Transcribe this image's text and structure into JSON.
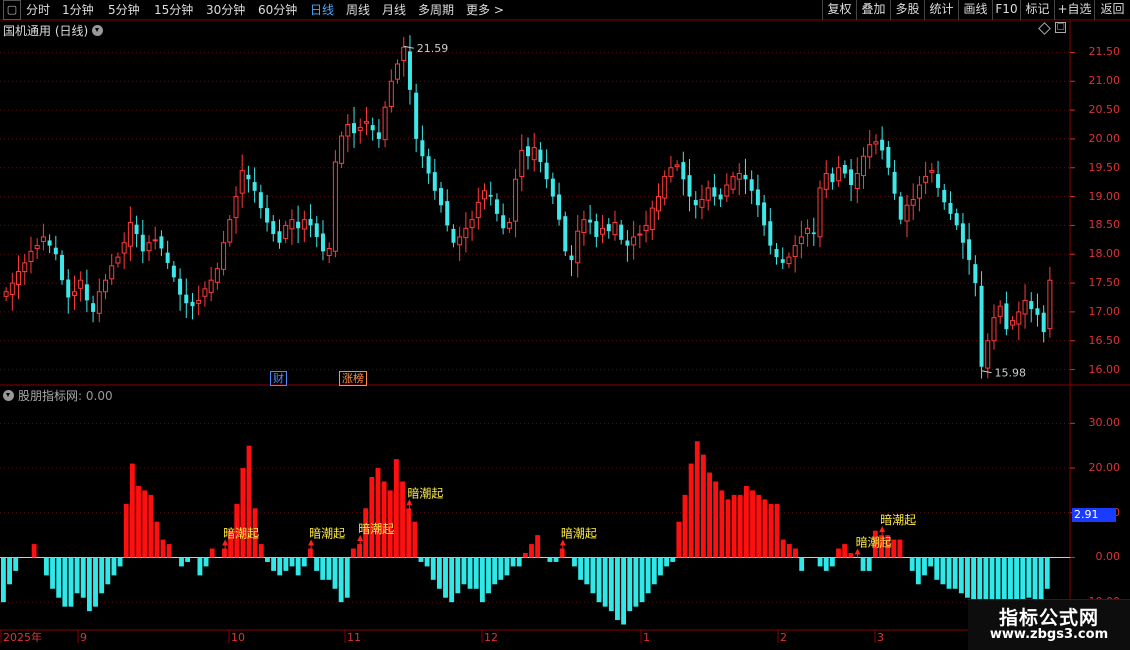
{
  "toolbar": {
    "menu_icon": "window-menu-icon",
    "periods": [
      {
        "label": "分时",
        "active": false
      },
      {
        "label": "1分钟",
        "active": false
      },
      {
        "label": "5分钟",
        "active": false
      },
      {
        "label": "15分钟",
        "active": false
      },
      {
        "label": "30分钟",
        "active": false
      },
      {
        "label": "60分钟",
        "active": false
      },
      {
        "label": "日线",
        "active": true
      },
      {
        "label": "周线",
        "active": false
      },
      {
        "label": "月线",
        "active": false
      },
      {
        "label": "多周期",
        "active": false
      },
      {
        "label": "更多 >",
        "active": false
      }
    ],
    "tools": [
      "复权",
      "叠加",
      "多股",
      "统计",
      "画线",
      "F10",
      "标记",
      "+自选",
      "返回"
    ]
  },
  "main_panel": {
    "title": "国机通用 (日线)",
    "high_label": "21.59",
    "low_label": "15.98",
    "tags": [
      {
        "text": "财",
        "color": "#4a8cff"
      },
      {
        "text": "涨榜",
        "color": "#ff9040"
      }
    ],
    "price_axis": [
      "21.50",
      "21.00",
      "20.50",
      "20.00",
      "19.50",
      "19.00",
      "18.50",
      "18.00",
      "17.50",
      "17.00",
      "16.50",
      "16.00"
    ]
  },
  "indicator_panel": {
    "title": "股朋指标网",
    "value": ": 0.00",
    "signal_label": "暗潮起",
    "current_value": "2.91",
    "axis": [
      "30.00",
      "20.00",
      "10.00",
      "0.00",
      "-10.00"
    ]
  },
  "date_axis": {
    "labels": [
      "2025年",
      "9",
      "10",
      "11",
      "12",
      "1",
      "2",
      "3"
    ]
  },
  "watermark": {
    "title": "指标公式网",
    "url": "www.zbgs3.com"
  },
  "colors": {
    "up": "#ff3b3b",
    "down": "#3ee8e8",
    "bar_up": "#ff1010",
    "bar_down": "#30e8e8",
    "grid": "#5a1010",
    "signal_text": "#ffee44"
  },
  "chart_data": [
    {
      "type": "candlestick",
      "title": "国机通用 (日线)",
      "y_axis_ticks": [
        16.0,
        16.5,
        17.0,
        17.5,
        18.0,
        18.5,
        19.0,
        19.5,
        20.0,
        20.5,
        21.0,
        21.5
      ],
      "ylim": [
        15.75,
        21.75
      ],
      "x_axis_labels": [
        "9",
        "10",
        "11",
        "12",
        "1",
        "2",
        "3"
      ],
      "annotations": [
        "21.59",
        "15.98"
      ],
      "closes": [
        17.35,
        17.5,
        17.7,
        17.85,
        18.05,
        18.15,
        18.3,
        18.15,
        18.0,
        17.55,
        17.25,
        17.35,
        17.55,
        17.2,
        17.0,
        17.35,
        17.55,
        17.8,
        17.95,
        18.2,
        18.55,
        18.35,
        18.05,
        18.2,
        18.25,
        18.1,
        17.85,
        17.6,
        17.3,
        17.15,
        17.1,
        17.2,
        17.4,
        17.55,
        17.75,
        18.2,
        18.6,
        19.0,
        19.45,
        19.3,
        19.1,
        18.8,
        18.55,
        18.35,
        18.2,
        18.5,
        18.6,
        18.45,
        18.6,
        18.5,
        18.3,
        18.05,
        18.1,
        19.6,
        20.05,
        20.25,
        20.1,
        20.2,
        20.3,
        20.15,
        20.0,
        20.55,
        21.0,
        21.3,
        21.59,
        20.85,
        20.0,
        19.7,
        19.4,
        19.1,
        18.85,
        18.5,
        18.2,
        18.3,
        18.45,
        18.6,
        18.9,
        19.1,
        19.0,
        18.7,
        18.45,
        18.55,
        19.3,
        19.8,
        19.7,
        19.85,
        19.6,
        19.3,
        19.0,
        18.6,
        18.05,
        17.9,
        18.4,
        18.6,
        18.55,
        18.3,
        18.45,
        18.4,
        18.55,
        18.25,
        18.15,
        18.3,
        18.35,
        18.5,
        18.8,
        19.0,
        19.35,
        19.5,
        19.55,
        19.3,
        19.0,
        18.85,
        18.95,
        19.15,
        19.0,
        18.95,
        19.2,
        19.35,
        19.4,
        19.3,
        19.1,
        18.85,
        18.5,
        18.15,
        17.95,
        17.85,
        17.95,
        18.15,
        18.3,
        18.45,
        18.35,
        19.15,
        19.4,
        19.25,
        19.5,
        19.4,
        19.2,
        19.4,
        19.7,
        19.9,
        19.95,
        19.8,
        19.5,
        19.05,
        18.6,
        18.85,
        18.95,
        19.2,
        19.35,
        19.45,
        19.15,
        18.9,
        18.7,
        18.5,
        18.2,
        17.9,
        17.5,
        16.05,
        16.5,
        16.9,
        17.1,
        16.7,
        16.85,
        17.0,
        17.2,
        17.05,
        16.95,
        16.65,
        17.55
      ]
    },
    {
      "type": "bar",
      "title": "股朋指标网",
      "y_axis_ticks": [
        -10,
        0,
        10,
        20,
        30
      ],
      "ylim": [
        -16,
        35
      ],
      "signal_marker": "暗潮起",
      "signals_at_index": [
        36,
        50,
        58,
        66,
        91,
        139,
        143
      ],
      "values": [
        -10,
        -6,
        -3,
        0,
        0,
        3,
        0,
        -4,
        -7,
        -9,
        -11,
        -11,
        -8,
        -9,
        -12,
        -11,
        -8,
        -6,
        -4,
        -2,
        12,
        21,
        16,
        15,
        14,
        8,
        4,
        3,
        0,
        -2,
        -1,
        0,
        -4,
        -2,
        2,
        0,
        2,
        6,
        12,
        20,
        25,
        11,
        3,
        -1,
        -3,
        -4,
        -3,
        -2,
        -4,
        -2,
        2,
        -3,
        -5,
        -5,
        -7,
        -10,
        -9,
        2,
        3,
        11,
        18,
        20,
        17,
        15,
        22,
        17,
        11,
        8,
        -1,
        -2,
        -5,
        -7,
        -9,
        -10,
        -8,
        -6,
        -7,
        -7,
        -10,
        -8,
        -6,
        -5,
        -4,
        -2,
        -2,
        1,
        3,
        5,
        0,
        -1,
        -1,
        2,
        0,
        -2,
        -5,
        -6,
        -8,
        -10,
        -11,
        -12,
        -14,
        -15,
        -12,
        -11,
        -10,
        -8,
        -6,
        -4,
        -2,
        -1,
        8,
        14,
        21,
        26,
        23,
        19,
        17,
        15,
        13,
        14,
        14,
        16,
        15,
        14,
        13,
        12,
        12,
        4,
        3,
        2,
        -3,
        0,
        0,
        -2,
        -3,
        -2,
        2,
        3,
        1,
        0,
        -3,
        -3,
        6,
        5,
        5,
        4,
        4,
        0,
        -3,
        -6,
        -4,
        -2,
        -5,
        -6,
        -7,
        -7,
        -8,
        -9,
        -10,
        -11,
        -11,
        -12,
        -14,
        -13,
        -12,
        -11,
        -10,
        -9,
        -14,
        -16,
        -7
      ]
    }
  ]
}
